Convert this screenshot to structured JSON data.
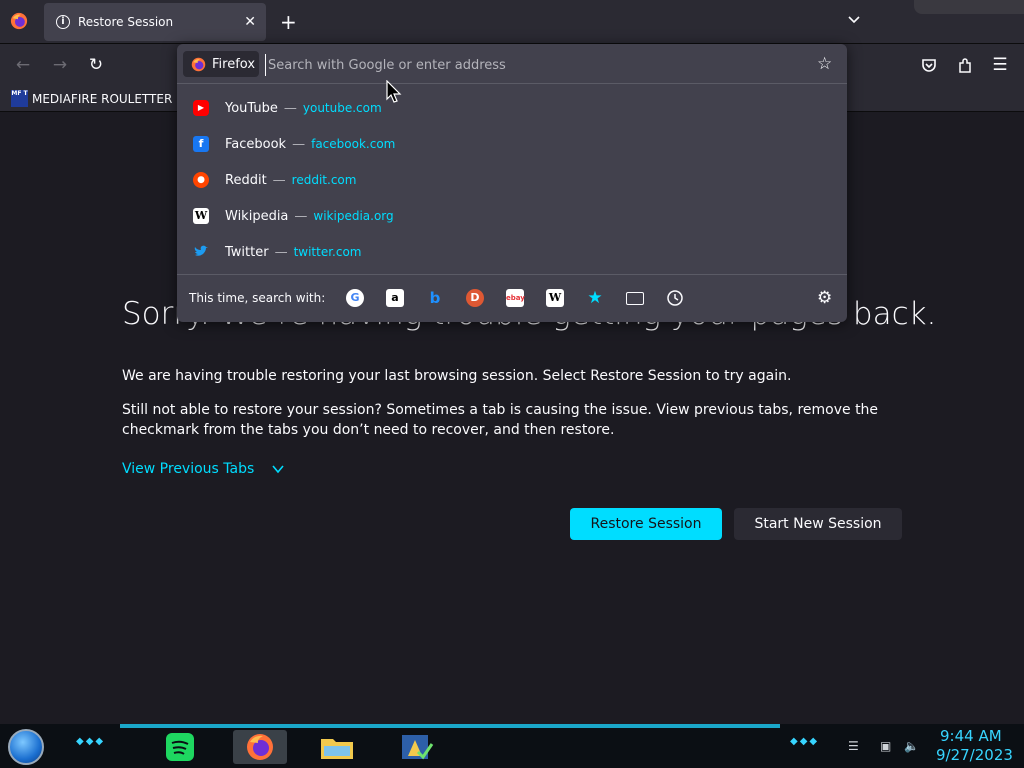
{
  "tab": {
    "title": "Restore Session",
    "close": "✕"
  },
  "toolbar": {
    "new_tab": "+"
  },
  "bookmarks": {
    "items": [
      {
        "icon_text": "MF T",
        "label": "MEDIAFIRE ROULETTER"
      }
    ]
  },
  "urlbar": {
    "engine_label": "Firefox",
    "placeholder": "Search with Google or enter address",
    "value": ""
  },
  "suggestions": [
    {
      "title": "YouTube",
      "url": "youtube.com",
      "icon": "youtube-icon",
      "color": "#ff0000"
    },
    {
      "title": "Facebook",
      "url": "facebook.com",
      "icon": "facebook-icon",
      "color": "#1877f2"
    },
    {
      "title": "Reddit",
      "url": "reddit.com",
      "icon": "reddit-icon",
      "color": "#ff4500"
    },
    {
      "title": "Wikipedia",
      "url": "wikipedia.org",
      "icon": "wikipedia-icon",
      "color": "#ffffff"
    },
    {
      "title": "Twitter",
      "url": "twitter.com",
      "icon": "twitter-icon",
      "color": "#1d9bf0"
    }
  ],
  "separator": "—",
  "oneoff": {
    "label": "This time, search with:",
    "engines": [
      "google-icon",
      "amazon-icon",
      "bing-icon",
      "duckduckgo-icon",
      "ebay-icon",
      "wikipedia-icon",
      "bookmarks-icon",
      "tabs-icon",
      "history-icon"
    ]
  },
  "page": {
    "title": "Sorry. We’re having trouble getting your pages back.",
    "para1": "We are having trouble restoring your last browsing session. Select Restore Session to try again.",
    "para2": "Still not able to restore your session? Sometimes a tab is causing the issue. View previous tabs, remove the checkmark from the tabs you don’t need to recover, and then restore.",
    "view_previous": "View Previous Tabs",
    "restore_label": "Restore Session",
    "new_session_label": "Start New Session"
  },
  "clock": {
    "time": "9:44 AM",
    "date": "9/27/2023"
  },
  "colors": {
    "accent": "#00ddff",
    "panel": "#42414d",
    "background": "#1c1b22",
    "chrome": "#2b2a33"
  }
}
